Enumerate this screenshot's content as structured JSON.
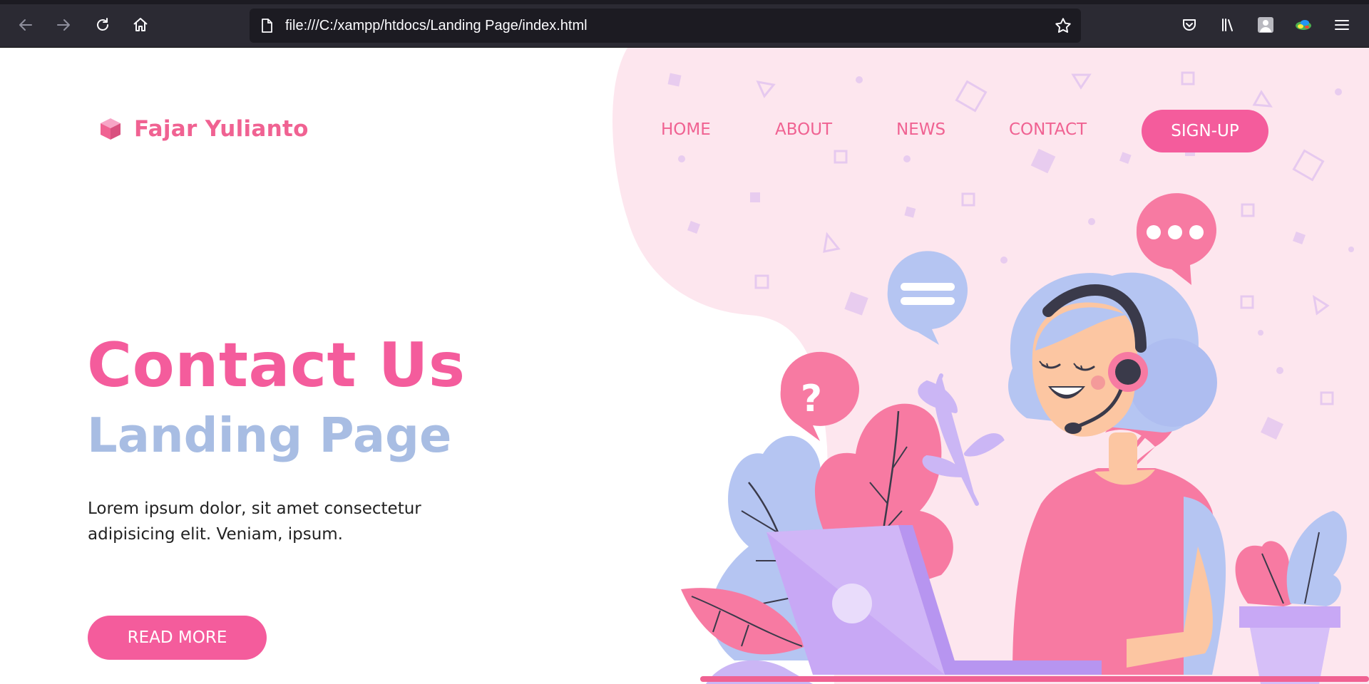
{
  "browser": {
    "url": "file:///C:/xampp/htdocs/Landing Page/index.html",
    "icons": [
      "back-icon",
      "forward-icon",
      "reload-icon",
      "home-icon",
      "page-icon",
      "bookmark-star-icon",
      "pocket-icon",
      "library-icon",
      "account-icon",
      "extension-icon",
      "menu-icon"
    ]
  },
  "header": {
    "brand": "Fajar Yulianto",
    "nav": [
      "HOME",
      "ABOUT",
      "NEWS",
      "CONTACT"
    ],
    "signup_label": "SIGN-UP"
  },
  "hero": {
    "title": "Contact Us",
    "subtitle": "Landing Page",
    "description": "Lorem ipsum dolor, sit amet consectetur adipisicing elit. Veniam, ipsum.",
    "button_label": "READ MORE"
  },
  "colors": {
    "accent_pink": "#f45c9c",
    "accent_blue": "#a8bde3",
    "blob_pink": "#fde6ee",
    "laptop_purple": "#c8a8f5"
  }
}
